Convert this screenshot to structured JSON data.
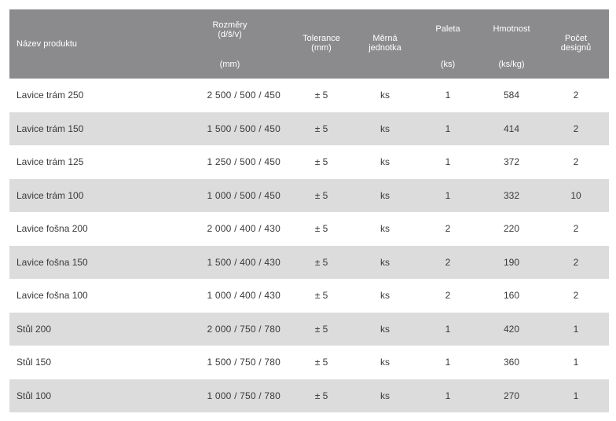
{
  "header": {
    "name": "Název produktu",
    "dims_line1": "Rozměry",
    "dims_line2": "(d/š/v)",
    "dims_unit": "(mm)",
    "tolerance_line1": "Tolerance",
    "tolerance_line2": "(mm)",
    "unit_line1": "Měrná",
    "unit_line2": "jednotka",
    "pallet_line1": "Paleta",
    "pallet_unit": "(ks)",
    "weight_line1": "Hmotnost",
    "weight_unit": "(ks/kg)",
    "designs_line1": "Počet",
    "designs_line2": "designů"
  },
  "rows": [
    {
      "name": "Lavice trám 250",
      "dims": "2 500 / 500 / 450",
      "tolerance": "± 5",
      "unit": "ks",
      "pallet": "1",
      "weight": "584",
      "designs": "2"
    },
    {
      "name": "Lavice trám 150",
      "dims": "1 500 / 500 / 450",
      "tolerance": "± 5",
      "unit": "ks",
      "pallet": "1",
      "weight": "414",
      "designs": "2"
    },
    {
      "name": "Lavice trám 125",
      "dims": "1 250 / 500 / 450",
      "tolerance": "± 5",
      "unit": "ks",
      "pallet": "1",
      "weight": "372",
      "designs": "2"
    },
    {
      "name": "Lavice trám 100",
      "dims": "1 000 / 500 / 450",
      "tolerance": "± 5",
      "unit": "ks",
      "pallet": "1",
      "weight": "332",
      "designs": "10"
    },
    {
      "name": "Lavice fošna 200",
      "dims": "2 000 / 400 / 430",
      "tolerance": "± 5",
      "unit": "ks",
      "pallet": "2",
      "weight": "220",
      "designs": "2"
    },
    {
      "name": "Lavice fošna 150",
      "dims": "1 500 / 400 / 430",
      "tolerance": "± 5",
      "unit": "ks",
      "pallet": "2",
      "weight": "190",
      "designs": "2"
    },
    {
      "name": "Lavice fošna 100",
      "dims": "1 000 / 400 / 430",
      "tolerance": "± 5",
      "unit": "ks",
      "pallet": "2",
      "weight": "160",
      "designs": "2"
    },
    {
      "name": "Stůl 200",
      "dims": "2 000 / 750 / 780",
      "tolerance": "± 5",
      "unit": "ks",
      "pallet": "1",
      "weight": "420",
      "designs": "1"
    },
    {
      "name": "Stůl 150",
      "dims": "1 500 / 750 / 780",
      "tolerance": "± 5",
      "unit": "ks",
      "pallet": "1",
      "weight": "360",
      "designs": "1"
    },
    {
      "name": "Stůl 100",
      "dims": "1 000 / 750 / 780",
      "tolerance": "± 5",
      "unit": "ks",
      "pallet": "1",
      "weight": "270",
      "designs": "1"
    }
  ]
}
